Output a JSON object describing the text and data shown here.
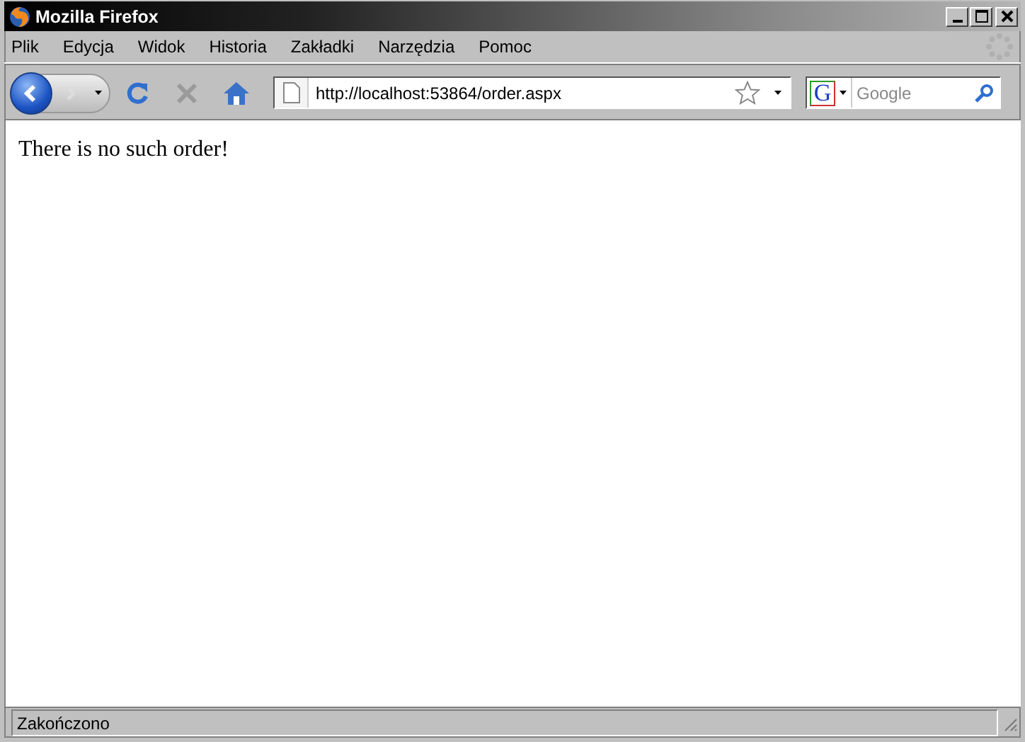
{
  "window": {
    "title": "Mozilla Firefox"
  },
  "menu": [
    "Plik",
    "Edycja",
    "Widok",
    "Historia",
    "Zakładki",
    "Narzędzia",
    "Pomoc"
  ],
  "toolbar": {
    "address": "http://localhost:53864/order.aspx",
    "search_engine": "G",
    "search_placeholder": "Google"
  },
  "content": {
    "text": "There is no such order!"
  },
  "status_bar": {
    "text": "Zakończono"
  }
}
